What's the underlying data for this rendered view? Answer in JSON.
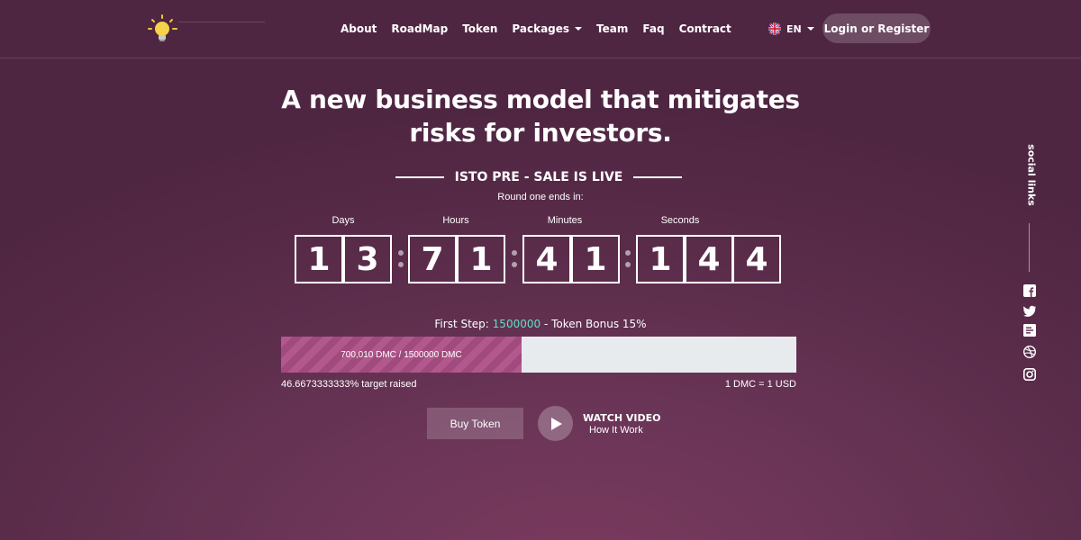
{
  "header": {
    "logo_icon": "lightbulb-icon",
    "nav": [
      {
        "label": "About",
        "dropdown": false
      },
      {
        "label": "RoadMap",
        "dropdown": false
      },
      {
        "label": "Token",
        "dropdown": false
      },
      {
        "label": "Packages",
        "dropdown": true
      },
      {
        "label": "Team",
        "dropdown": false
      },
      {
        "label": "Faq",
        "dropdown": false
      },
      {
        "label": "Contract",
        "dropdown": false
      }
    ],
    "language": {
      "label": "EN",
      "flag_icon": "uk-flag-icon"
    },
    "login_label": "Login or Register"
  },
  "hero": {
    "headline_line1": "A new business model that mitigates",
    "headline_line2": "risks for investors.",
    "presale_title": "ISTO PRE - SALE IS LIVE",
    "round_text": "Round one ends in:"
  },
  "countdown": {
    "days_label": "Days",
    "hours_label": "Hours",
    "minutes_label": "Minutes",
    "seconds_label": "Seconds",
    "days": [
      "1",
      "3"
    ],
    "hours": [
      "7",
      "1"
    ],
    "minutes": [
      "4",
      "1"
    ],
    "seconds": [
      "1",
      "4",
      "4"
    ]
  },
  "sale": {
    "step_prefix": "First Step:",
    "step_target": "1500000",
    "step_suffix": "- Token Bonus 15%",
    "progress_text": "700,010 DMC / 1500000 DMC",
    "progress_fraction": 0.4667,
    "raised_text": "46.6673333333% target raised",
    "rate_text": "1 DMC = 1 USD",
    "buy_label": "Buy Token",
    "watch_label": "WATCH VIDEO",
    "how_label": "How It Work"
  },
  "social": {
    "title": "social links",
    "icons": [
      "facebook-icon",
      "twitter-icon",
      "medium-icon",
      "dribbble-icon",
      "instagram-icon"
    ]
  },
  "colors": {
    "accent": "#5fe0c8",
    "progress_fill": "#b2588d",
    "progress_track": "#e8ebee"
  }
}
